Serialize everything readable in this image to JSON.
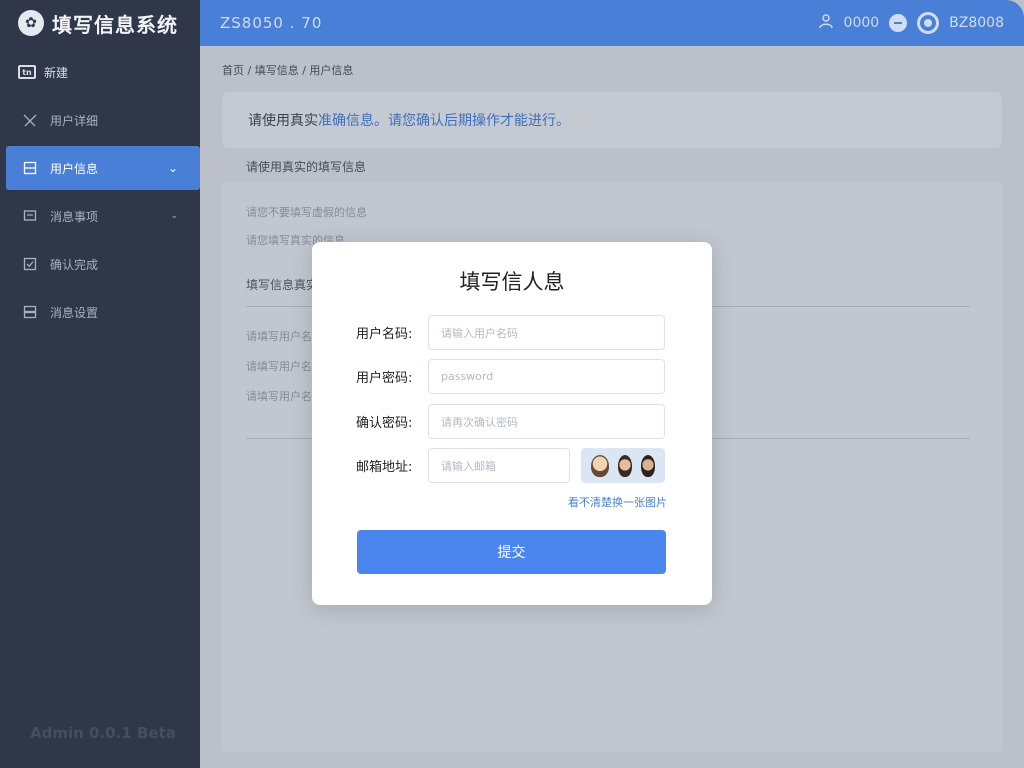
{
  "app": {
    "title": "填写信息系统"
  },
  "sidebar": {
    "section_label": "新建",
    "section_icon": "box-icon",
    "items": [
      {
        "label": "用户详细",
        "icon": "user-icon",
        "active": false,
        "has_chevron": false
      },
      {
        "label": "用户信息",
        "icon": "form-icon",
        "active": true,
        "has_chevron": true
      },
      {
        "label": "消息事项",
        "icon": "monitor-icon",
        "active": false,
        "has_chevron": true
      },
      {
        "label": "确认完成",
        "icon": "checkbox-icon",
        "active": false,
        "has_chevron": false
      },
      {
        "label": "消息设置",
        "icon": "list-icon",
        "active": false,
        "has_chevron": false
      }
    ],
    "footer": "Admin 0.0.1 Beta"
  },
  "topbar": {
    "left_text": "ZS8050 . 70",
    "user_label": "0000",
    "right_text": "BZ8008"
  },
  "main": {
    "breadcrumb": "首页 / 填写信息 / 用户信息",
    "notice_prefix": "请使用真实",
    "notice_highlight": "准确信息。请您确认后期操作才能进行。",
    "subtitle": "请使用真实的填写信息",
    "lines": [
      "请您不要填写虚假的信息",
      "请您填写真实的信息"
    ],
    "group_title": "填写信息真实",
    "form_lines": [
      "请填写用户名和",
      "请填写用户名",
      "请填写用户名"
    ]
  },
  "modal": {
    "title": "填写信人息",
    "fields": [
      {
        "label": "用户名码:",
        "placeholder": "请输入用户名码",
        "name": "username"
      },
      {
        "label": "用户密码:",
        "placeholder": "password",
        "name": "password"
      },
      {
        "label": "确认密码:",
        "placeholder": "请再次确认密码",
        "name": "confirm-password"
      },
      {
        "label": "邮箱地址:",
        "placeholder": "请输入邮箱",
        "name": "email"
      }
    ],
    "refresh_link": "看不清楚换一张图片",
    "submit_label": "提交"
  },
  "colors": {
    "accent": "#4a7fd8",
    "sidebar_bg": "#2f3749",
    "button": "#4a86ee"
  }
}
